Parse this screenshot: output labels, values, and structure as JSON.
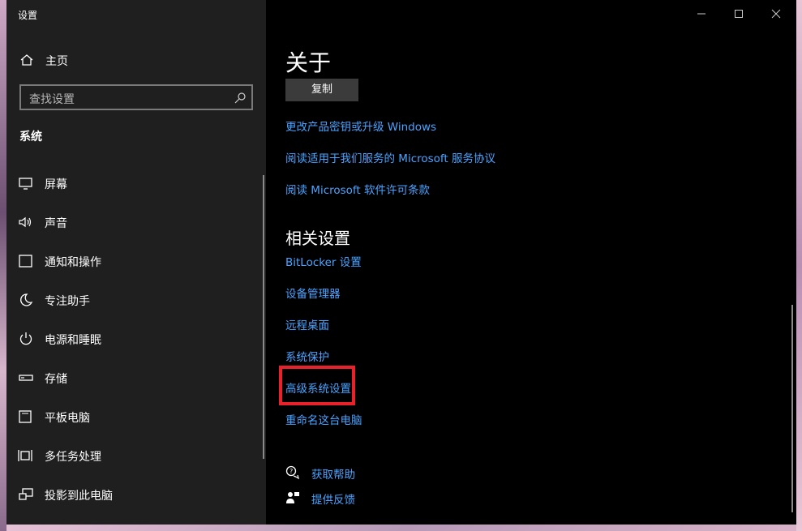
{
  "window": {
    "title": "设置"
  },
  "sidebar": {
    "home_label": "主页",
    "search_placeholder": "查找设置",
    "section_title": "系统",
    "items": [
      {
        "label": "屏幕",
        "icon": "display-icon"
      },
      {
        "label": "声音",
        "icon": "speaker-icon"
      },
      {
        "label": "通知和操作",
        "icon": "notification-icon"
      },
      {
        "label": "专注助手",
        "icon": "moon-icon"
      },
      {
        "label": "电源和睡眠",
        "icon": "power-icon"
      },
      {
        "label": "存储",
        "icon": "storage-icon"
      },
      {
        "label": "平板电脑",
        "icon": "tablet-icon"
      },
      {
        "label": "多任务处理",
        "icon": "multitask-icon"
      },
      {
        "label": "投影到此电脑",
        "icon": "project-icon"
      }
    ]
  },
  "content": {
    "title": "关于",
    "copy_button": "复制",
    "links": [
      "更改产品密钥或升级 Windows",
      "阅读适用于我们服务的 Microsoft 服务协议",
      "阅读 Microsoft 软件许可条款"
    ],
    "related_title": "相关设置",
    "related_links": [
      "BitLocker 设置",
      "设备管理器",
      "远程桌面",
      "系统保护",
      "高级系统设置",
      "重命名这台电脑"
    ],
    "help_links": [
      {
        "label": "获取帮助",
        "icon": "help-chat-icon"
      },
      {
        "label": "提供反馈",
        "icon": "feedback-icon"
      }
    ]
  },
  "colors": {
    "link": "#4aa3ff",
    "highlight": "#e8212a",
    "sidebar_bg": "#1f1f1f",
    "content_bg": "#000000"
  }
}
